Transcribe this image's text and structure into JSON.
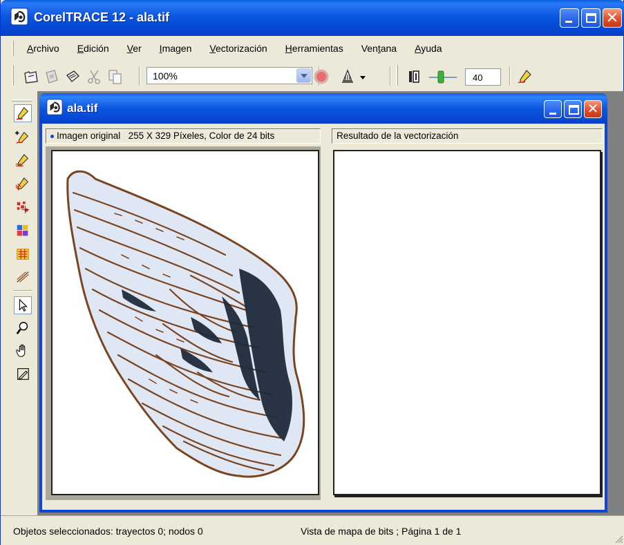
{
  "window": {
    "title": "CorelTRACE 12 - ala.tif",
    "controls": {
      "minimize": "minimize",
      "maximize": "maximize",
      "close": "close"
    }
  },
  "menu": [
    {
      "label": "Archivo",
      "ul": "A",
      "rest": "rchivo"
    },
    {
      "label": "Edición",
      "ul": "E",
      "rest": "dición"
    },
    {
      "label": "Ver",
      "ul": "V",
      "rest": "er"
    },
    {
      "label": "Imagen",
      "ul": "I",
      "rest": "magen"
    },
    {
      "label": "Vectorización",
      "ul": "V",
      "rest": "ectorización"
    },
    {
      "label": "Herramientas",
      "ul": "H",
      "rest": "erramientas"
    },
    {
      "label": "Ventana",
      "pre": "Ven",
      "ul": "t",
      "rest": "ana"
    },
    {
      "label": "Ayuda",
      "ul": "A",
      "rest": "yuda"
    }
  ],
  "toolbar": {
    "zoom_value": "100%",
    "detail_value": "40",
    "icons": [
      "open-icon",
      "save-icon",
      "print-icon",
      "cut-icon",
      "copy-icon",
      "stop-icon",
      "trace-mode-icon",
      "detail-icon",
      "slider-icon",
      "trace-settings-icon"
    ]
  },
  "toolbox": {
    "tools": [
      "outline-trace-icon",
      "centerline-trace-icon",
      "sketch-trace-icon",
      "woodcut-trace-icon",
      "mosaic-trace-icon",
      "3d-mosaic-trace-icon",
      "ocr-trace-icon",
      "form-trace-icon",
      "pick-tool-icon",
      "zoom-tool-icon",
      "pan-tool-icon",
      "eyedropper-tool-icon"
    ]
  },
  "document": {
    "title": "ala.tif",
    "original_label": "Imagen original",
    "original_info": "255 X 329 Píxeles, Color de 24 bits",
    "result_label": "Resultado de la vectorización"
  },
  "status": {
    "left": "Objetos seleccionados: trayectos 0; nodos 0",
    "right": "Vista de mapa de bits ; Página 1 de 1"
  },
  "colors": {
    "title_blue": "#0a46d8",
    "face": "#ece9d8",
    "close_red": "#e0502a",
    "wing_fill": "#dbe5f5",
    "wing_stroke": "#8a4a18",
    "wing_dark": "#202a3a"
  }
}
